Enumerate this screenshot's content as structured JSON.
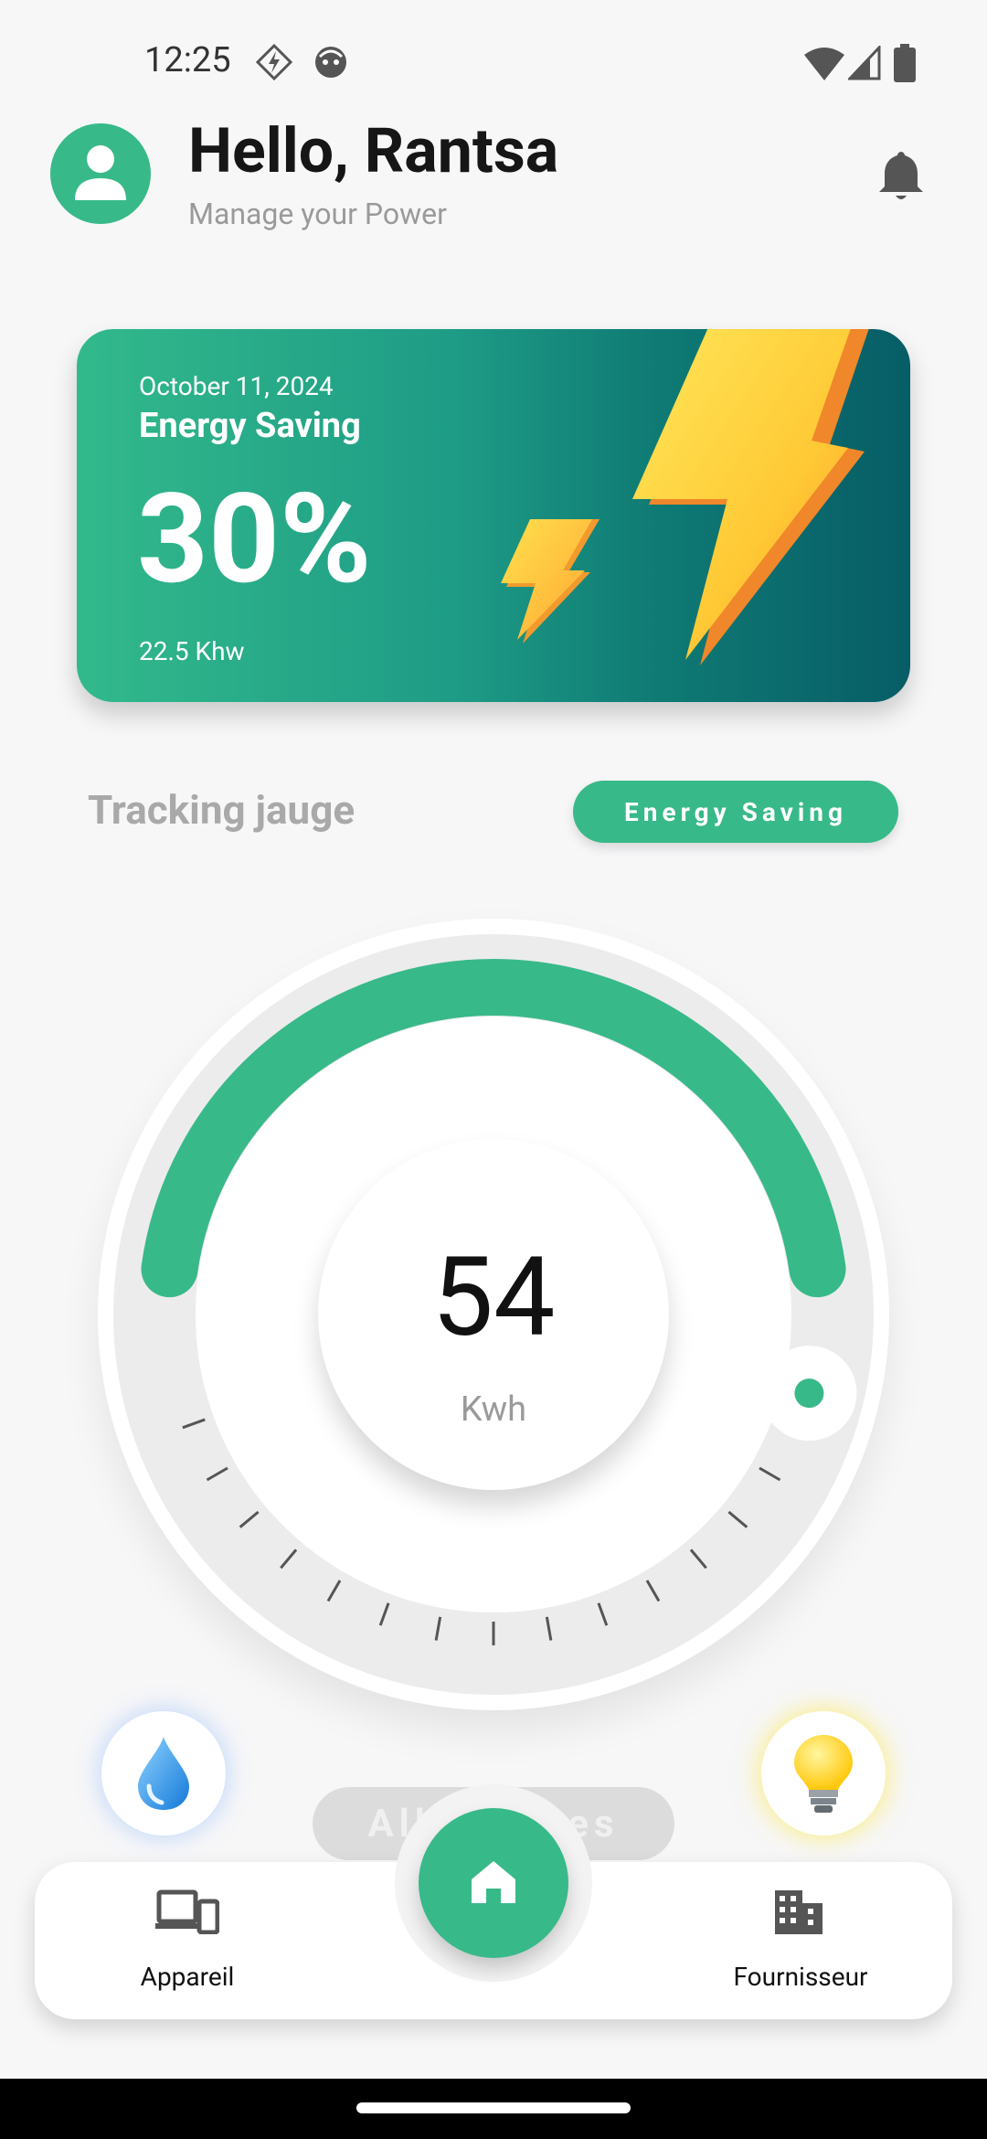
{
  "status_bar": {
    "time": "12:25",
    "left_icons": [
      "bolt-badge-icon",
      "face-icon"
    ],
    "right_icons": [
      "wifi-icon",
      "signal-icon",
      "battery-icon"
    ]
  },
  "header": {
    "greeting": "Hello, Rantsa",
    "subtitle": "Manage your Power",
    "avatar_icon": "person-icon",
    "notification_icon": "bell-icon"
  },
  "energy_card": {
    "date": "October 11, 2024",
    "title": "Energy Saving",
    "percent": "30%",
    "energy": "22.5 Khw",
    "icons": [
      "lightning-bolt-large-icon",
      "lightning-bolt-small-icon"
    ]
  },
  "tracking": {
    "title": "Tracking jauge",
    "mode_button": "Energy Saving"
  },
  "gauge": {
    "value": "54",
    "unit": "Kwh",
    "level_fraction": 0.5
  },
  "quick_actions": {
    "water_icon": "water-drop-icon",
    "light_icon": "light-bulb-icon",
    "all_devices_label": "All Devices"
  },
  "bottom_nav": {
    "items": [
      {
        "label": "Appareil",
        "icon": "devices-icon"
      },
      {
        "label": "Fournisseur",
        "icon": "building-icon"
      }
    ],
    "center_icon": "home-icon"
  },
  "colors": {
    "accent": "#38b98a",
    "card_gradient_end": "#075d66",
    "background": "#f7f7f8"
  }
}
